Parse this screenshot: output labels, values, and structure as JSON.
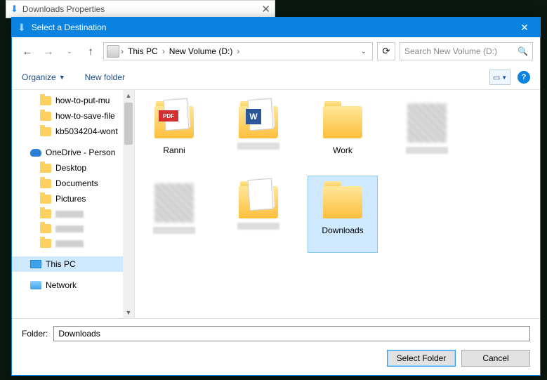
{
  "parent_window": {
    "title": "Downloads Properties"
  },
  "dialog": {
    "title": "Select a Destination",
    "breadcrumb": {
      "root": "This PC",
      "drive": "New Volume (D:)"
    },
    "search_placeholder": "Search New Volume (D:)",
    "toolbar": {
      "organize": "Organize",
      "new_folder": "New folder"
    },
    "folder_label": "Folder:",
    "folder_value": "Downloads",
    "select_btn": "Select Folder",
    "cancel_btn": "Cancel"
  },
  "sidebar": {
    "quick": [
      "how-to-put-mu",
      "how-to-save-file",
      "kb5034204-wont"
    ],
    "onedrive": "OneDrive - Person",
    "onedrive_children": [
      "Desktop",
      "Documents",
      "Pictures"
    ],
    "this_pc": "This PC",
    "network": "Network"
  },
  "files": {
    "ranni": "Ranni",
    "work": "Work",
    "downloads": "Downloads"
  }
}
